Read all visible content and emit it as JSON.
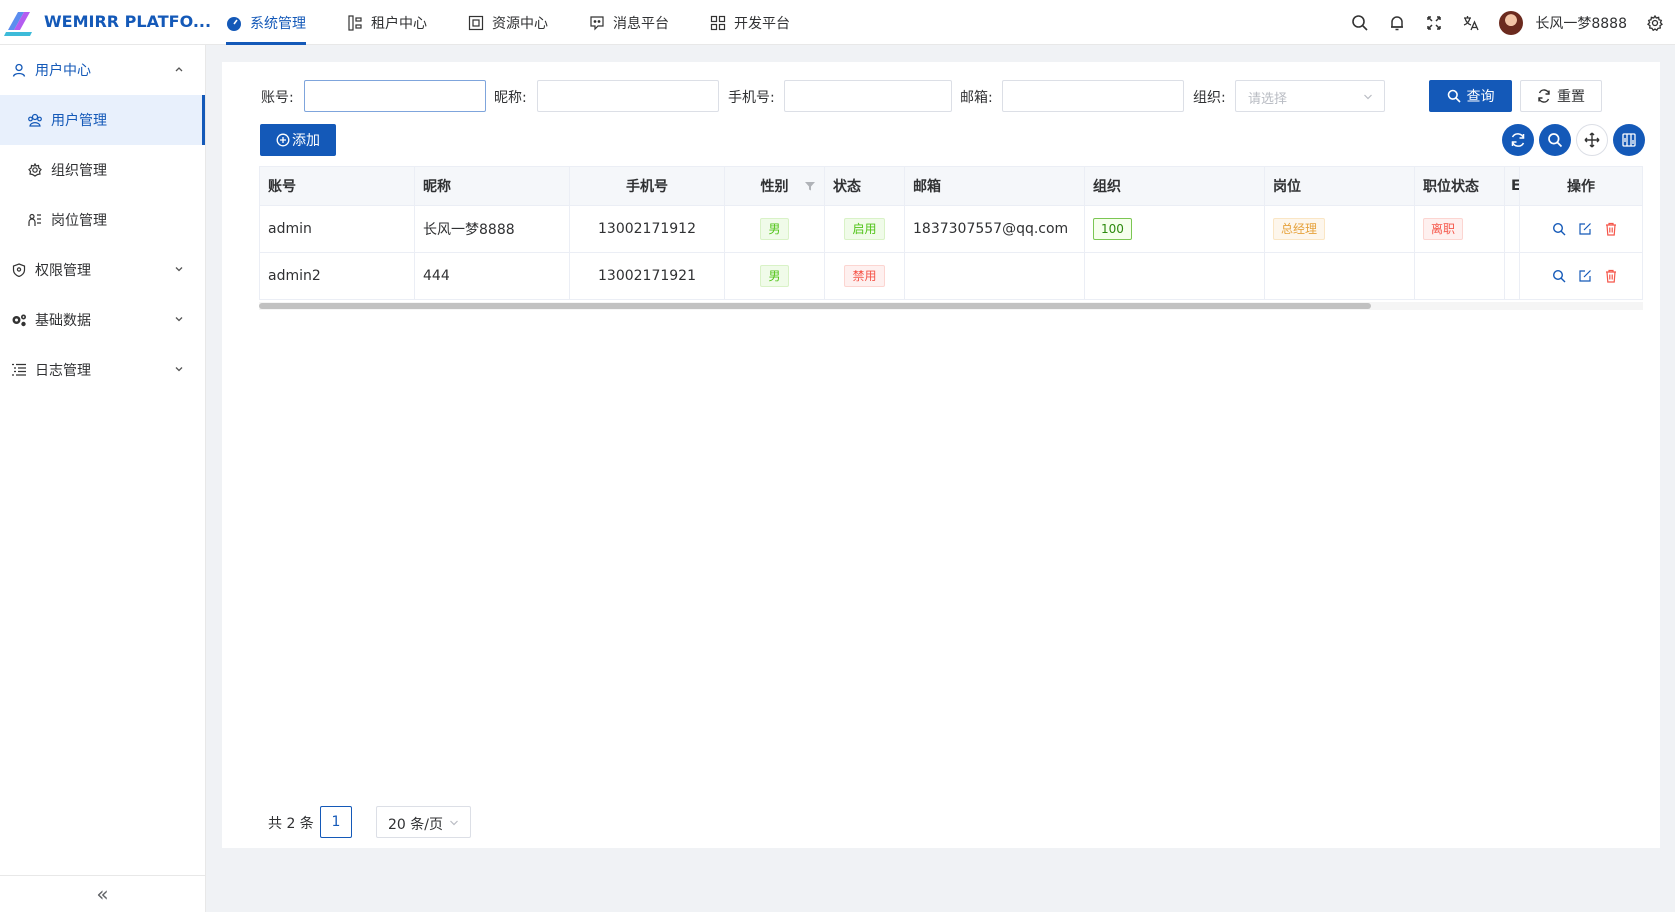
{
  "app": {
    "title": "WEMIRR PLATFO..."
  },
  "topnav": [
    {
      "label": "系统管理",
      "icon": "dashboard-icon",
      "active": true
    },
    {
      "label": "租户中心",
      "icon": "tenant-icon"
    },
    {
      "label": "资源中心",
      "icon": "resource-icon"
    },
    {
      "label": "消息平台",
      "icon": "message-icon"
    },
    {
      "label": "开发平台",
      "icon": "dev-icon"
    }
  ],
  "user": {
    "name": "长风一梦8888"
  },
  "sidebar": {
    "groups": [
      {
        "label": "用户中心",
        "icon": "user-icon",
        "open": true,
        "items": [
          {
            "label": "用户管理",
            "icon": "users-icon",
            "active": true
          },
          {
            "label": "组织管理",
            "icon": "org-icon"
          },
          {
            "label": "岗位管理",
            "icon": "post-icon"
          }
        ]
      },
      {
        "label": "权限管理",
        "icon": "shield-icon"
      },
      {
        "label": "基础数据",
        "icon": "gears-icon"
      },
      {
        "label": "日志管理",
        "icon": "list-icon"
      }
    ],
    "collapse": "«"
  },
  "search": {
    "account_label": "账号:",
    "nickname_label": "昵称:",
    "mobile_label": "手机号:",
    "email_label": "邮箱:",
    "org_label": "组织:",
    "org_placeholder": "请选择",
    "query_button": "查询",
    "reset_button": "重置"
  },
  "toolbar": {
    "add_button": "添加"
  },
  "table": {
    "headers": [
      "账号",
      "昵称",
      "手机号",
      "性别",
      "状态",
      "邮箱",
      "组织",
      "岗位",
      "职位状态",
      "E",
      "操作"
    ],
    "rows": [
      {
        "account": "admin",
        "nickname": "长风一梦8888",
        "mobile": "13002171912",
        "sex": "男",
        "status": "启用",
        "email": "1837307557@qq.com",
        "org": "100",
        "post": "总经理",
        "post_status": "离职"
      },
      {
        "account": "admin2",
        "nickname": "444",
        "mobile": "13002171921",
        "sex": "男",
        "status": "禁用",
        "email": "",
        "org": "",
        "post": "",
        "post_status": ""
      }
    ]
  },
  "pagination": {
    "total": "共 2 条",
    "page": "1",
    "page_size": "20 条/页"
  },
  "colors": {
    "primary": "#1459b8",
    "success": "#52c41a",
    "danger": "#f5564a",
    "warning": "#e6a23c"
  }
}
